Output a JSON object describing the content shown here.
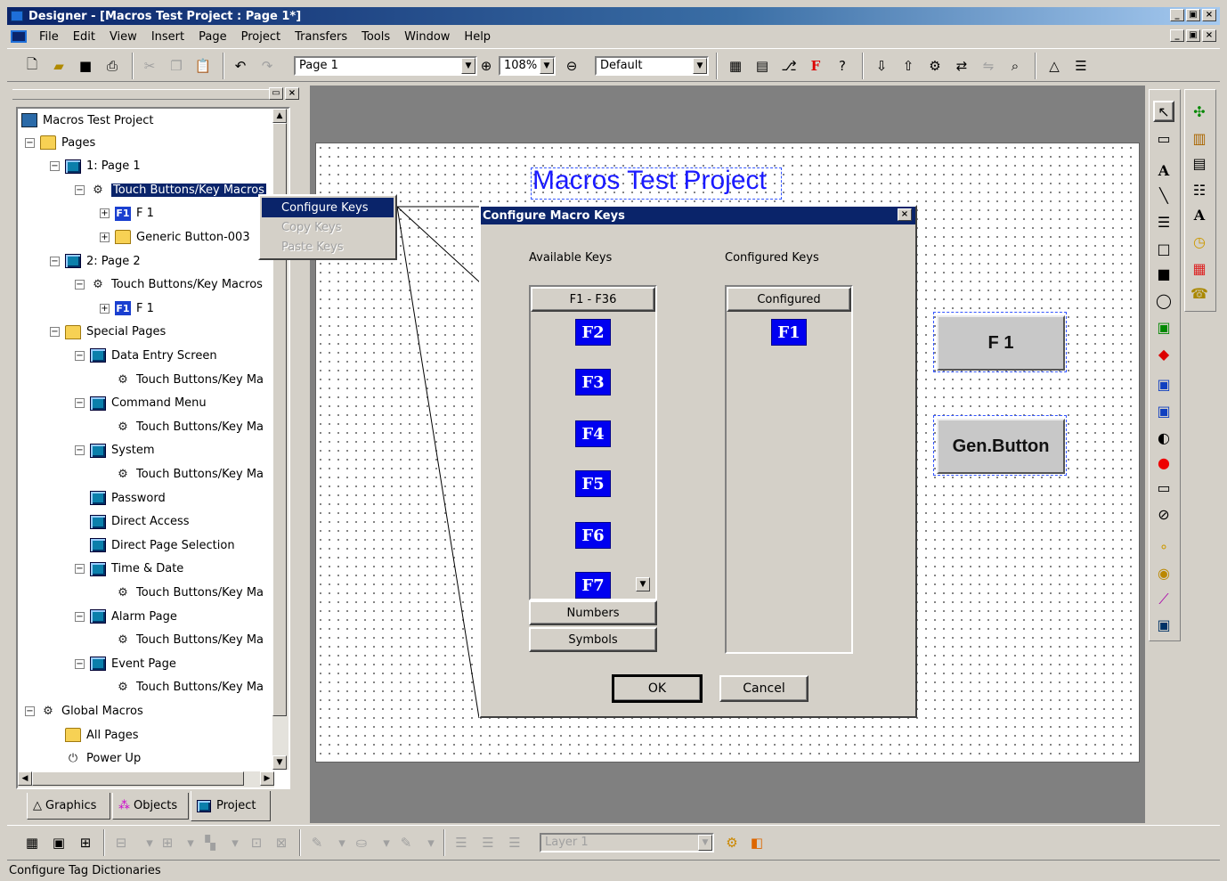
{
  "window": {
    "title": "Designer - [Macros Test Project : Page 1*]",
    "controls": [
      "_",
      "▣",
      "×"
    ]
  },
  "menu": [
    "File",
    "Edit",
    "View",
    "Insert",
    "Page",
    "Project",
    "Transfers",
    "Tools",
    "Window",
    "Help"
  ],
  "toolbar": {
    "page_combo": "Page 1",
    "zoom_combo": "108%",
    "style_combo": "Default"
  },
  "tree": {
    "root": "Macros Test Project",
    "rows": [
      {
        "label": "Pages",
        "icon": "folder-icon",
        "exp": "−"
      },
      {
        "label": "1: Page 1",
        "icon": "page-icon",
        "exp": "−"
      },
      {
        "label": "Touch Buttons/Key Macros",
        "icon": "gear-icon",
        "exp": "−"
      },
      {
        "label": "F 1",
        "icon": "fkey-icon",
        "exp": "+"
      },
      {
        "label": "Generic Button-003",
        "icon": "folder-icon",
        "exp": "+"
      },
      {
        "label": "2: Page 2",
        "icon": "page-icon",
        "exp": "−"
      },
      {
        "label": "Touch Buttons/Key Macros",
        "icon": "gear-icon",
        "exp": "−"
      },
      {
        "label": "F 1",
        "icon": "fkey-icon",
        "exp": "+"
      },
      {
        "label": "Special Pages",
        "icon": "folder-icon",
        "exp": "−"
      },
      {
        "label": "Data Entry Screen",
        "icon": "page-icon",
        "exp": "−"
      },
      {
        "label": "Touch Buttons/Key Ma",
        "icon": "gear-icon",
        "exp": ""
      },
      {
        "label": "Command Menu",
        "icon": "page-icon",
        "exp": "−"
      },
      {
        "label": "Touch Buttons/Key Ma",
        "icon": "gear-icon",
        "exp": ""
      },
      {
        "label": "System",
        "icon": "page-icon",
        "exp": "−"
      },
      {
        "label": "Touch Buttons/Key Ma",
        "icon": "gear-icon",
        "exp": ""
      },
      {
        "label": "Password",
        "icon": "page-icon",
        "exp": ""
      },
      {
        "label": "Direct Access",
        "icon": "page-icon",
        "exp": ""
      },
      {
        "label": "Direct Page Selection",
        "icon": "page-icon",
        "exp": ""
      },
      {
        "label": "Time & Date",
        "icon": "page-icon",
        "exp": "−"
      },
      {
        "label": "Touch Buttons/Key Ma",
        "icon": "gear-icon",
        "exp": ""
      },
      {
        "label": "Alarm Page",
        "icon": "page-icon",
        "exp": "−"
      },
      {
        "label": "Touch Buttons/Key Ma",
        "icon": "gear-icon",
        "exp": ""
      },
      {
        "label": "Event Page",
        "icon": "page-icon",
        "exp": "−"
      },
      {
        "label": "Touch Buttons/Key Ma",
        "icon": "gear-icon",
        "exp": ""
      },
      {
        "label": "Global Macros",
        "icon": "gear-icon",
        "exp": "−"
      },
      {
        "label": "All Pages",
        "icon": "folder-icon",
        "exp": ""
      },
      {
        "label": "Power Up",
        "icon": "power-icon",
        "exp": ""
      }
    ]
  },
  "context_menu": {
    "items": [
      {
        "label": "Configure Keys",
        "state": "active"
      },
      {
        "label": "Copy Keys",
        "state": "disabled"
      },
      {
        "label": "Paste Keys",
        "state": "disabled"
      }
    ]
  },
  "panel_tabs": [
    "Graphics",
    "Objects",
    "Project"
  ],
  "canvas": {
    "title": "Macros Test Project",
    "buttons": [
      "F 1",
      "Gen.Button"
    ]
  },
  "dialog": {
    "title": "Configure Macro Keys",
    "available_label": "Available Keys",
    "configured_label": "Configured Keys",
    "available_header": "F1 - F36",
    "configured_header": "Configured",
    "available_keys": [
      "F2",
      "F3",
      "F4",
      "F5",
      "F6",
      "F7"
    ],
    "configured_keys": [
      "F1"
    ],
    "numbers_button": "Numbers",
    "symbols_button": "Symbols",
    "ok_button": "OK",
    "cancel_button": "Cancel"
  },
  "bottom_toolbar": {
    "layer_combo": "Layer 1"
  },
  "status": "Configure Tag Dictionaries",
  "colors": {
    "titlebar": "#0a246a",
    "key_chip": "#0000f0",
    "canvas_title": "#1a1aff"
  }
}
